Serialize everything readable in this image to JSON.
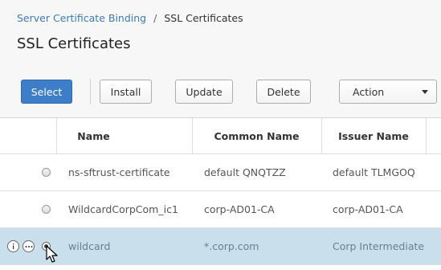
{
  "breadcrumb": {
    "parent": "Server Certificate Binding",
    "separator": "/",
    "current": "SSL Certificates"
  },
  "page": {
    "title": "SSL Certificates"
  },
  "toolbar": {
    "select_label": "Select",
    "install_label": "Install",
    "update_label": "Update",
    "delete_label": "Delete",
    "action_label": "Action"
  },
  "table": {
    "columns": [
      "Name",
      "Common Name",
      "Issuer Name"
    ],
    "rows": [
      {
        "name": "ns-sftrust-certificate",
        "common_name": "default QNQTZZ",
        "issuer_name": "default TLMGOQ",
        "selected": false
      },
      {
        "name": "WildcardCorpCom_ic1",
        "common_name": "corp-AD01-CA",
        "issuer_name": "corp-AD01-CA",
        "selected": false
      },
      {
        "name": "wildcard",
        "common_name": "*.corp.com",
        "issuer_name": "Corp Intermediate",
        "selected": true
      }
    ]
  },
  "icons": {
    "info": "info-icon",
    "more": "more-options-icon",
    "cursor": "mouse-pointer-icon"
  },
  "colors": {
    "primary_button": "#3e7ec8",
    "link": "#3f7ab8",
    "selected_row": "#c9dfec"
  }
}
